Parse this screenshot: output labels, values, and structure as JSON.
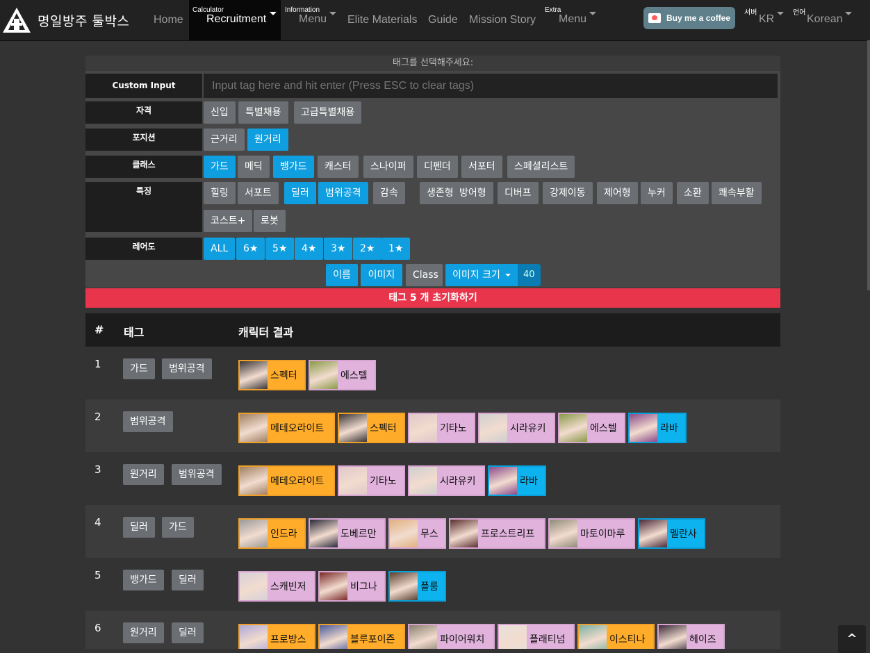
{
  "navbar": {
    "brand_title": "명일방주 툴박스",
    "home": "Home",
    "recruitment": {
      "small": "Calculator",
      "label": "Recruitment"
    },
    "information": {
      "small": "Information",
      "label": "Menu"
    },
    "elite": "Elite Materials",
    "guide": "Guide",
    "mission_story": "Mission Story",
    "extra": {
      "small": "Extra",
      "label": "Menu"
    },
    "coffee_label": "Buy me a coffee",
    "server": {
      "small": "서버",
      "label": "KR"
    },
    "language": {
      "small": "언어",
      "label": "Korean"
    }
  },
  "panel": {
    "header": "태그를 선택해주세요:",
    "custom_input_label": "Custom Input",
    "custom_input_placeholder": "Input tag here and hit enter (Press ESC to clear tags)",
    "rows": [
      {
        "label": "자격",
        "tags": [
          {
            "t": "신입",
            "on": false
          },
          {
            "t": "특별채용",
            "on": false
          },
          {
            "t": "고급특별채용",
            "on": false
          }
        ]
      },
      {
        "label": "포지션",
        "tags": [
          {
            "t": "근거리",
            "on": false
          },
          {
            "t": "원거리",
            "on": true
          }
        ]
      },
      {
        "label": "클래스",
        "tags": [
          {
            "t": "가드",
            "on": true
          },
          {
            "t": "메딕",
            "on": false
          },
          {
            "t": "뱅가드",
            "on": true
          },
          {
            "t": "캐스터",
            "on": false
          },
          {
            "t": "스나이퍼",
            "on": false
          },
          {
            "t": "디펜더",
            "on": false
          },
          {
            "t": "서포터",
            "on": false
          },
          {
            "t": "스페셜리스트",
            "on": false
          }
        ]
      },
      {
        "label": "특징",
        "tags": [
          {
            "t": "힐링",
            "on": false
          },
          {
            "t": "서포트",
            "on": false
          },
          {
            "t": "딜러",
            "on": true
          },
          {
            "t": "범위공격",
            "on": true
          },
          {
            "t": "감속",
            "on": false
          },
          {
            "t": "생존형",
            "on": false
          },
          {
            "t": "방어형",
            "on": false
          },
          {
            "t": "디버프",
            "on": false
          },
          {
            "t": "강제이동",
            "on": false
          },
          {
            "t": "제어형",
            "on": false
          },
          {
            "t": "누커",
            "on": false
          },
          {
            "t": "소환",
            "on": false
          },
          {
            "t": "쾌속부활",
            "on": false
          },
          {
            "t": "코스트+",
            "on": false
          },
          {
            "t": "로봇",
            "on": false
          }
        ]
      },
      {
        "label": "레어도",
        "tags": [
          {
            "t": "ALL",
            "on": true
          },
          {
            "t": "6★",
            "on": true
          },
          {
            "t": "5★",
            "on": true
          },
          {
            "t": "4★",
            "on": true
          },
          {
            "t": "3★",
            "on": true
          },
          {
            "t": "2★",
            "on": true
          },
          {
            "t": "1★",
            "on": true
          }
        ]
      }
    ],
    "controls": {
      "name": "이름",
      "image": "이미지",
      "class": "Class",
      "image_size": "이미지 크기",
      "size_value": "40"
    },
    "clear_label": "태그 5 개 초기화하기"
  },
  "results": {
    "headers": {
      "num": "#",
      "tags": "태그",
      "chars": "캐릭터 결과"
    },
    "rows": [
      {
        "num": "1",
        "tags": [
          "가드",
          "범위공격"
        ],
        "ops": [
          {
            "n": "스펙터",
            "r": 6,
            "c": "#3a3636"
          },
          {
            "n": "에스텔",
            "r": 5,
            "c": "#8a9a4a"
          }
        ]
      },
      {
        "num": "2",
        "tags": [
          "범위공격"
        ],
        "ops": [
          {
            "n": "메테오라이트",
            "r": 6,
            "c": "#a08060"
          },
          {
            "n": "스펙터",
            "r": 6,
            "c": "#3a3636"
          },
          {
            "n": "기타노",
            "r": 5,
            "c": "#e0c8c8"
          },
          {
            "n": "시라유키",
            "r": 5,
            "c": "#cfcfcf"
          },
          {
            "n": "에스텔",
            "r": 5,
            "c": "#8a9a4a"
          },
          {
            "n": "라바",
            "r": 4,
            "c": "#8a4a8a"
          }
        ]
      },
      {
        "num": "3",
        "tags": [
          "원거리",
          "범위공격"
        ],
        "ops": [
          {
            "n": "메테오라이트",
            "r": 6,
            "c": "#a08060"
          },
          {
            "n": "기타노",
            "r": 5,
            "c": "#e0c8c8"
          },
          {
            "n": "시라유키",
            "r": 5,
            "c": "#cfcfcf"
          },
          {
            "n": "라바",
            "r": 4,
            "c": "#8a4a8a"
          }
        ]
      },
      {
        "num": "4",
        "tags": [
          "딜러",
          "가드"
        ],
        "ops": [
          {
            "n": "인드라",
            "r": 6,
            "c": "#9a9a9a"
          },
          {
            "n": "도베르만",
            "r": 5,
            "c": "#2a2a3a"
          },
          {
            "n": "무스",
            "r": 5,
            "c": "#e0b080"
          },
          {
            "n": "프로스트리프",
            "r": 5,
            "c": "#5a3030"
          },
          {
            "n": "마토이마루",
            "r": 5,
            "c": "#908a7a"
          },
          {
            "n": "멜란사",
            "r": 4,
            "c": "#4a2a3a"
          }
        ]
      },
      {
        "num": "5",
        "tags": [
          "뱅가드",
          "딜러"
        ],
        "ops": [
          {
            "n": "스캐빈저",
            "r": 5,
            "c": "#d8d0d8"
          },
          {
            "n": "비그나",
            "r": 5,
            "c": "#7a2a2a"
          },
          {
            "n": "플룸",
            "r": 4,
            "c": "#5a4030"
          }
        ]
      },
      {
        "num": "6",
        "tags": [
          "원거리",
          "딜러"
        ],
        "ops": [
          {
            "n": "프로방스",
            "r": 6,
            "c": "#b0a8d8"
          },
          {
            "n": "블루포이즌",
            "r": 6,
            "c": "#4a5a9a"
          },
          {
            "n": "파이어워치",
            "r": 5,
            "c": "#8a8070"
          },
          {
            "n": "플래티넘",
            "r": 5,
            "c": "#e8e0d8"
          },
          {
            "n": "이스티나",
            "r": 6,
            "c": "#7ab0a0"
          },
          {
            "n": "헤이즈",
            "r": 5,
            "c": "#3a2a3a"
          }
        ]
      }
    ]
  },
  "scroll_top_label": "^"
}
